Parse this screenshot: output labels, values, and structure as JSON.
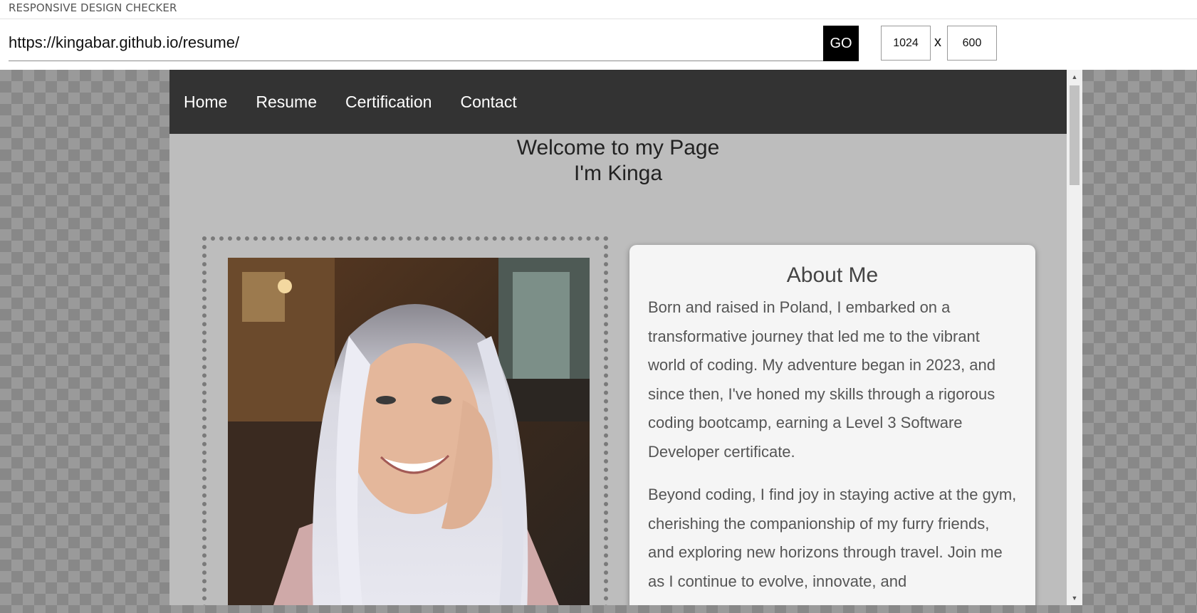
{
  "app": {
    "title": "RESPONSIVE DESIGN CHECKER",
    "url_value": "https://kingabar.github.io/resume/",
    "go_label": "GO",
    "width_value": "1024",
    "height_value": "600",
    "dimension_separator": "x"
  },
  "site": {
    "nav": [
      "Home",
      "Resume",
      "Certification",
      "Contact"
    ],
    "heading_line1": "Welcome to my Page",
    "heading_line2": "I'm Kinga",
    "about": {
      "title": "About Me",
      "paragraph1": "Born and raised in Poland, I embarked on a transformative journey that led me to the vibrant world of coding. My adventure began in 2023, and since then, I've honed my skills through a rigorous coding bootcamp, earning a Level 3 Software Developer certificate.",
      "paragraph2": "Beyond coding, I find joy in staying active at the gym, cherishing the companionship of my furry friends, and exploring new horizons through travel. Join me as I continue to evolve, innovate, and"
    }
  },
  "colors": {
    "nav_background": "#333333",
    "page_background": "#bdbdbd",
    "card_background": "#f5f5f5"
  }
}
